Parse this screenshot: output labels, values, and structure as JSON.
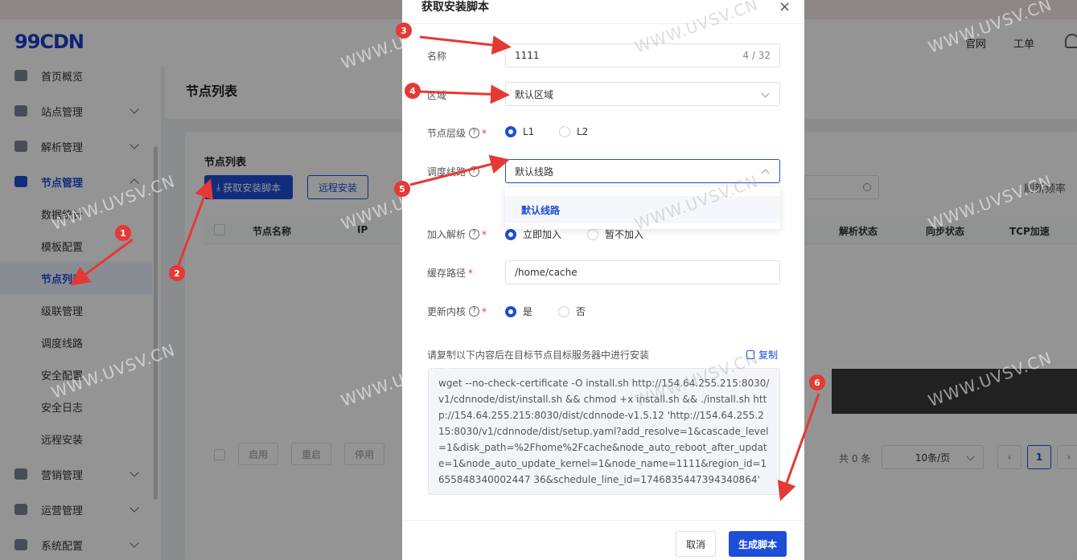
{
  "app": {
    "logo": "99CDN",
    "header_links": [
      "官网",
      "工单"
    ]
  },
  "sidebar": {
    "items": [
      {
        "label": "首页概览",
        "icon": "home-icon"
      },
      {
        "label": "站点管理",
        "icon": "site-icon"
      },
      {
        "label": "解析管理",
        "icon": "globe-icon"
      },
      {
        "label": "节点管理",
        "icon": "node-icon"
      },
      {
        "label": "数据统计"
      },
      {
        "label": "模板配置"
      },
      {
        "label": "节点列表"
      },
      {
        "label": "级联管理"
      },
      {
        "label": "调度线路"
      },
      {
        "label": "安全配置"
      },
      {
        "label": "安全日志"
      },
      {
        "label": "远程安装"
      },
      {
        "label": "营销管理",
        "icon": "marketing-icon"
      },
      {
        "label": "运营管理",
        "icon": "operation-icon"
      },
      {
        "label": "系统配置",
        "icon": "settings-icon"
      }
    ]
  },
  "page": {
    "title": "节点列表",
    "card_title": "节点列表",
    "btn_get_script": "获取安装脚本",
    "btn_remote_install": "远程安装",
    "refresh_label": "刷新频率",
    "columns": [
      "节点名称",
      "IP",
      "解析状态",
      "同步状态",
      "TCP加速"
    ],
    "footer_buttons": [
      "启用",
      "重启",
      "停用"
    ],
    "total": "共 0 条",
    "page_size": "10条/页",
    "current_page": "1"
  },
  "modal": {
    "title": "获取安装脚本",
    "close": "×",
    "name_label": "名称",
    "name_value": "1111",
    "name_count": "4 / 32",
    "region_label": "区域",
    "region_value": "默认区域",
    "level_label": "节点层级",
    "level_options": [
      "L1",
      "L2"
    ],
    "line_label": "调度线路",
    "line_value": "默认线路",
    "line_dropdown_option": "默认线路",
    "resolve_label": "加入解析",
    "resolve_options": [
      "立即加入",
      "暂不加入"
    ],
    "cache_label": "缓存路径",
    "cache_value": "/home/cache",
    "kernel_label": "更新内核",
    "kernel_options": [
      "是",
      "否"
    ],
    "copy_hint": "请复制以下内容后在目标节点目标服务器中进行安装",
    "copy_link": "复制",
    "script": "wget --no-check-certificate -O install.sh http://154.64.255.215:8030/v1/cdnnode/dist/install.sh && chmod +x install.sh && ./install.sh http://154.64.255.215:8030/dist/cdnnode-v1.5.12 'http://154.64.255.215:8030/v1/cdnnode/dist/setup.yaml?add_resolve=1&cascade_level=1&disk_path=%2Fhome%2Fcache&node_auto_reboot_after_update=1&node_auto_update_kernel=1&node_name=1111&region_id=1655848340002447 36&schedule_line_id=1746835447394340864'",
    "btn_cancel": "取消",
    "btn_generate": "生成脚本"
  },
  "annotations": [
    "1",
    "2",
    "3",
    "4",
    "5",
    "6"
  ],
  "watermark": "WWW.UVSV.CN",
  "colors": {
    "primary": "#1d4ed8",
    "danger": "#e53935"
  }
}
